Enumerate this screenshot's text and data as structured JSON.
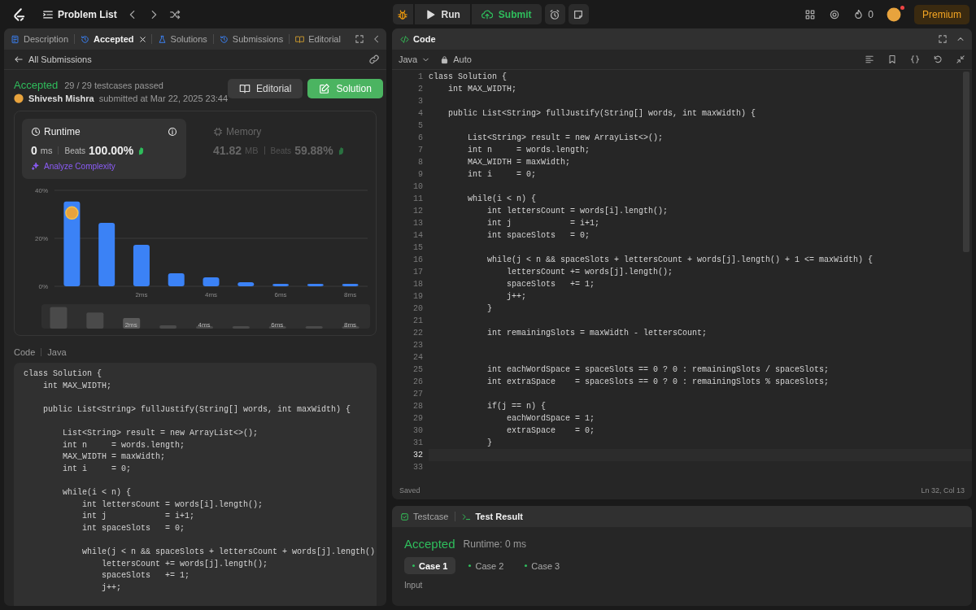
{
  "top_bar": {
    "title": "Problem List",
    "run": "Run",
    "submit": "Submit",
    "streak": "0",
    "premium": "Premium"
  },
  "left_panel": {
    "tabs": [
      {
        "label": "Description",
        "selected": false,
        "closable": false
      },
      {
        "label": "Accepted",
        "selected": true,
        "closable": true
      },
      {
        "label": "Solutions",
        "selected": false,
        "closable": false
      },
      {
        "label": "Submissions",
        "selected": false,
        "closable": false
      },
      {
        "label": "Editorial",
        "selected": false,
        "closable": false
      }
    ],
    "back_link": "All Submissions",
    "submission": {
      "status": "Accepted",
      "passed": "29 / 29 testcases passed",
      "user": "Shivesh Mishra",
      "submitted": "submitted at Mar 22, 2025 23:44",
      "editorial_button": "Editorial",
      "solution_button": "Solution"
    },
    "stats": [
      {
        "kind": "runtime",
        "title": "Runtime",
        "value": "0",
        "unit": "ms",
        "beats_label": "Beats",
        "beats": "100.00%",
        "selected": true,
        "link": "Analyze Complexity"
      },
      {
        "kind": "memory",
        "title": "Memory",
        "value": "41.82",
        "unit": "MB",
        "beats_label": "Beats",
        "beats": "59.88%",
        "selected": false
      }
    ],
    "chart_data": {
      "type": "bar",
      "x": [
        0,
        1,
        2,
        3,
        4,
        5,
        6,
        7,
        8
      ],
      "xlim": [
        -0.5,
        8.5
      ],
      "values": [
        35.3,
        26.4,
        17.3,
        5.4,
        3.7,
        1.7,
        1,
        1,
        1
      ],
      "ylim": [
        0,
        40
      ],
      "yticks": [
        {
          "value": 0,
          "label": "0%"
        },
        {
          "value": 20,
          "label": "20%"
        },
        {
          "value": 40,
          "label": "40%"
        }
      ],
      "xticks": [
        {
          "value": 2,
          "label": "2ms"
        },
        {
          "value": 4,
          "label": "4ms"
        },
        {
          "value": 6,
          "label": "6ms"
        },
        {
          "value": 8,
          "label": "8ms"
        }
      ]
    },
    "overview_labels": [
      "2ms",
      "4ms",
      "6ms",
      "8ms"
    ],
    "code_label": "Code",
    "code_language": "Java",
    "code": "class Solution {\n    int MAX_WIDTH;\n\n    public List<String> fullJustify(String[] words, int maxWidth) {\n\n        List<String> result = new ArrayList<>();\n        int n     = words.length;\n        MAX_WIDTH = maxWidth;\n        int i     = 0;\n\n        while(i < n) {\n            int lettersCount = words[i].length();\n            int j            = i+1;\n            int spaceSlots   = 0;\n\n            while(j < n && spaceSlots + lettersCount + words[j].length()\n                lettersCount += words[j].length();\n                spaceSlots   += 1;\n                j++;"
  },
  "editor": {
    "title": "Code",
    "language": "Java",
    "mode": "Auto",
    "status": "Saved",
    "cursor": "Ln 32, Col 13",
    "lines": [
      {
        "number": "1",
        "text": "class Solution {",
        "current": false
      },
      {
        "number": "2",
        "text": "    int MAX_WIDTH;",
        "current": false
      },
      {
        "number": "3",
        "current": false
      },
      {
        "number": "4",
        "text": "    public List<String> fullJustify(String[] words, int maxWidth) {",
        "current": false
      },
      {
        "number": "5",
        "current": false
      },
      {
        "number": "6",
        "text": "        List<String> result = new ArrayList<>();",
        "current": false
      },
      {
        "number": "7",
        "text": "        int n     = words.length;",
        "current": false
      },
      {
        "number": "8",
        "text": "        MAX_WIDTH = maxWidth;",
        "current": false
      },
      {
        "number": "9",
        "text": "        int i     = 0;",
        "current": false
      },
      {
        "number": "10",
        "current": false
      },
      {
        "number": "11",
        "text": "        while(i < n) {",
        "current": false
      },
      {
        "number": "12",
        "text": "            int lettersCount = words[i].length();",
        "current": false
      },
      {
        "number": "13",
        "text": "            int j            = i+1;",
        "current": false
      },
      {
        "number": "14",
        "text": "            int spaceSlots   = 0;",
        "current": false
      },
      {
        "number": "15",
        "current": false
      },
      {
        "number": "16",
        "text": "            while(j < n && spaceSlots + lettersCount + words[j].length() + 1 <= maxWidth) {",
        "current": false
      },
      {
        "number": "17",
        "text": "                lettersCount += words[j].length();",
        "current": false
      },
      {
        "number": "18",
        "text": "                spaceSlots   += 1;",
        "current": false
      },
      {
        "number": "19",
        "text": "                j++;",
        "current": false
      },
      {
        "number": "20",
        "text": "            }",
        "current": false
      },
      {
        "number": "21",
        "current": false
      },
      {
        "number": "22",
        "text": "            int remainingSlots = maxWidth - lettersCount;",
        "current": false
      },
      {
        "number": "23",
        "current": false
      },
      {
        "number": "24",
        "current": false
      },
      {
        "number": "25",
        "text": "            int eachWordSpace = spaceSlots == 0 ? 0 : remainingSlots / spaceSlots;",
        "current": false
      },
      {
        "number": "26",
        "text": "            int extraSpace    = spaceSlots == 0 ? 0 : remainingSlots % spaceSlots;",
        "current": false
      },
      {
        "number": "27",
        "current": false
      },
      {
        "number": "28",
        "text": "            if(j == n) {",
        "current": false
      },
      {
        "number": "29",
        "text": "                eachWordSpace = 1;",
        "current": false
      },
      {
        "number": "30",
        "text": "                extraSpace    = 0;",
        "current": false
      },
      {
        "number": "31",
        "text": "            }",
        "current": false
      },
      {
        "number": "32",
        "current": true
      },
      {
        "number": "33",
        "current": false
      }
    ]
  },
  "result_panel": {
    "tabs": [
      {
        "label": "Testcase",
        "selected": false
      },
      {
        "label": "Test Result",
        "selected": true
      }
    ],
    "status": "Accepted",
    "runtime": "Runtime: 0 ms",
    "cases": [
      {
        "label": "Case 1",
        "selected": true
      },
      {
        "label": "Case 2",
        "selected": false
      },
      {
        "label": "Case 3",
        "selected": false
      }
    ],
    "input_label": "Input"
  }
}
